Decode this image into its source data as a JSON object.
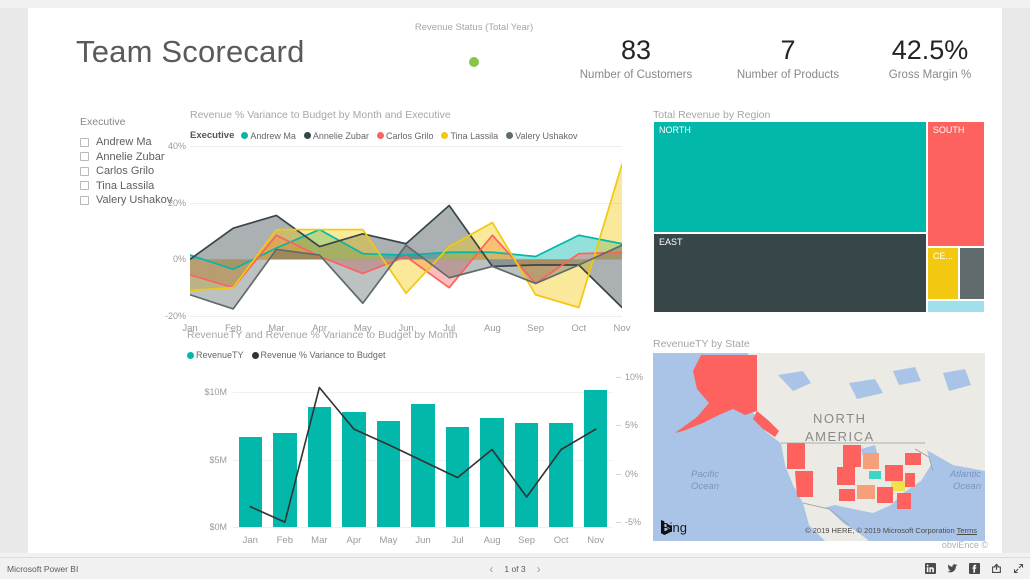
{
  "report": {
    "title": "Team Scorecard",
    "watermark": "obviEnce ©"
  },
  "kpis": {
    "status": {
      "header": "Revenue Status (Total Year)",
      "indicator_color": "#8bc34a"
    },
    "customers": {
      "value": "83",
      "label": "Number of Customers"
    },
    "products": {
      "value": "7",
      "label": "Number of Products"
    },
    "margin": {
      "value": "42.5%",
      "label": "Gross Margin %"
    }
  },
  "slicer": {
    "title": "Executive",
    "items": [
      {
        "label": "Andrew Ma",
        "checked": false
      },
      {
        "label": "Annelie Zubar",
        "checked": false
      },
      {
        "label": "Carlos Grilo",
        "checked": false
      },
      {
        "label": "Tina Lassila",
        "checked": false
      },
      {
        "label": "Valery Ushakov",
        "checked": false
      }
    ]
  },
  "visuals": {
    "line_chart_title": "Revenue % Variance to Budget by Month and Executive",
    "combo_chart_title": "RevenueTY and Revenue % Variance to Budget by Month",
    "treemap_title": "Total Revenue by Region",
    "map_title": "RevenueTY by State"
  },
  "map": {
    "continent_label_line1": "NORTH",
    "continent_label_line2": "AMERICA",
    "ocean_left_line1": "Pacific",
    "ocean_left_line2": "Ocean",
    "ocean_right_line1": "Atlantic",
    "ocean_right_line2": "Ocean",
    "provider": "Bing",
    "credit": "© 2019 HERE, © 2019 Microsoft Corporation",
    "credit_link": "Terms"
  },
  "statusbar": {
    "brand": "Microsoft Power BI",
    "page_indicator": "1 of 3",
    "prev": "‹",
    "next": "›",
    "icons": [
      "linkedin-icon",
      "twitter-icon",
      "facebook-icon",
      "share-icon",
      "fullscreen-icon"
    ]
  },
  "chart_data": [
    {
      "type": "area",
      "title": "Revenue % Variance to Budget by Month and Executive",
      "legend_title": "Executive",
      "legend_position": "top",
      "xlabel": "",
      "ylabel": "",
      "ylim": [
        -20,
        40
      ],
      "yticks": [
        40,
        20,
        0,
        -20
      ],
      "ytick_labels": [
        "40%",
        "20%",
        "0%",
        "-20%"
      ],
      "grid": true,
      "categories": [
        "Jan",
        "Feb",
        "Mar",
        "Apr",
        "May",
        "Jun",
        "Jul",
        "Aug",
        "Sep",
        "Oct",
        "Nov"
      ],
      "series": [
        {
          "name": "Andrew Ma",
          "color": "#01b8aa",
          "values": [
            1.5,
            -3.5,
            4.0,
            10.5,
            2.0,
            1.5,
            2.5,
            2.5,
            1.0,
            8.5,
            5.5
          ]
        },
        {
          "name": "Annelie Zubar",
          "color": "#374649",
          "values": [
            0.0,
            11.0,
            15.5,
            4.5,
            9.0,
            5.5,
            19.0,
            -2.5,
            -2.0,
            -2.0,
            -17.0
          ]
        },
        {
          "name": "Carlos Grilo",
          "color": "#fd625e",
          "values": [
            -5.5,
            -10.0,
            8.5,
            1.0,
            -5.0,
            1.0,
            -10.0,
            8.5,
            -8.5,
            2.0,
            2.5
          ]
        },
        {
          "name": "Tina Lassila",
          "color": "#f2c811",
          "values": [
            -11.0,
            -10.0,
            10.5,
            10.5,
            10.5,
            -12.0,
            4.5,
            13.0,
            -12.5,
            -17.0,
            33.5
          ]
        },
        {
          "name": "Valery Ushakov",
          "color": "#5f6b6d",
          "values": [
            -12.5,
            -17.5,
            3.5,
            1.5,
            -15.5,
            5.0,
            -6.5,
            -2.5,
            -8.5,
            -2.0,
            5.0
          ]
        }
      ]
    },
    {
      "type": "bar",
      "title": "RevenueTY and Revenue % Variance to Budget by Month",
      "legend_position": "top",
      "categories": [
        "Jan",
        "Feb",
        "Mar",
        "Apr",
        "May",
        "Jun",
        "Jul",
        "Aug",
        "Sep",
        "Oct",
        "Nov"
      ],
      "left_axis": {
        "label": "RevenueTY",
        "ylim": [
          0,
          11.5
        ],
        "yticks": [
          0,
          5,
          10
        ],
        "ytick_labels": [
          "$0M",
          "$5M",
          "$10M"
        ]
      },
      "right_axis": {
        "label": "Revenue % Variance to Budget",
        "ylim": [
          -5.5,
          10.5
        ],
        "yticks": [
          10,
          5,
          0,
          -5
        ],
        "ytick_labels": [
          "10%",
          "5%",
          "0%",
          "-5%"
        ]
      },
      "series": [
        {
          "name": "RevenueTY",
          "kind": "bar",
          "color": "#01b8aa",
          "values": [
            6.7,
            7.0,
            8.9,
            8.5,
            7.9,
            9.1,
            7.4,
            8.1,
            7.7,
            7.7,
            10.2
          ]
        },
        {
          "name": "Revenue % Variance to Budget",
          "kind": "line",
          "color": "#333333",
          "values": [
            -3.4,
            -5.0,
            8.9,
            4.6,
            3.0,
            1.3,
            -0.4,
            2.5,
            -2.4,
            2.5,
            4.6
          ]
        }
      ]
    },
    {
      "type": "treemap",
      "title": "Total Revenue by Region",
      "slices": [
        {
          "label": "NORTH",
          "color": "#01b8aa",
          "weight": 42.0
        },
        {
          "label": "EAST",
          "color": "#374649",
          "weight": 38.0
        },
        {
          "label": "SOUTH",
          "color": "#fd625e",
          "weight": 12.0
        },
        {
          "label": "CE...",
          "color": "#f2c811",
          "weight": 3.2
        },
        {
          "label": "",
          "color": "#5f6b6d",
          "weight": 2.8
        },
        {
          "label": "",
          "color": "#a0e0ec",
          "weight": 2.0
        }
      ]
    },
    {
      "type": "map",
      "title": "RevenueTY by State",
      "region": "North America",
      "bubble_color": "#fd625e"
    }
  ]
}
